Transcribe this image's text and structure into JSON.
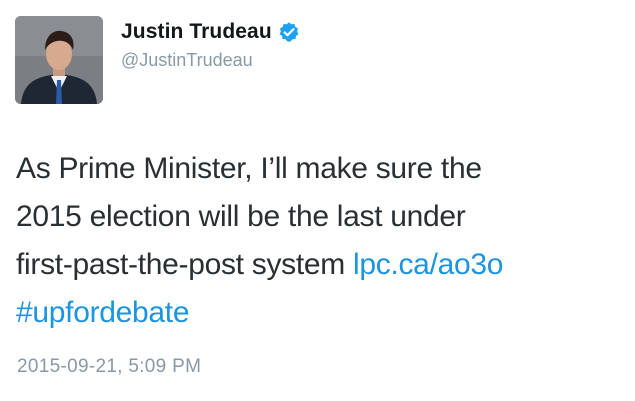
{
  "author": {
    "display_name": "Justin Trudeau",
    "handle": "@JustinTrudeau",
    "verified": true
  },
  "tweet": {
    "line1": "As Prime Minister, I’ll make sure the",
    "line2": "2015 election will be the last under",
    "line3_text": "first-past-the-post system ",
    "link": "lpc.ca/ao3o",
    "hashtag": "#upfordebate",
    "timestamp": "2015-09-21, 5:09 PM"
  },
  "colors": {
    "link": "#1b95e0",
    "verified_badge": "#1da1f2",
    "muted_text": "#8899a6",
    "body_text": "#292f33"
  },
  "icons": {
    "verified": "verified-badge-icon",
    "avatar": "profile-photo"
  }
}
